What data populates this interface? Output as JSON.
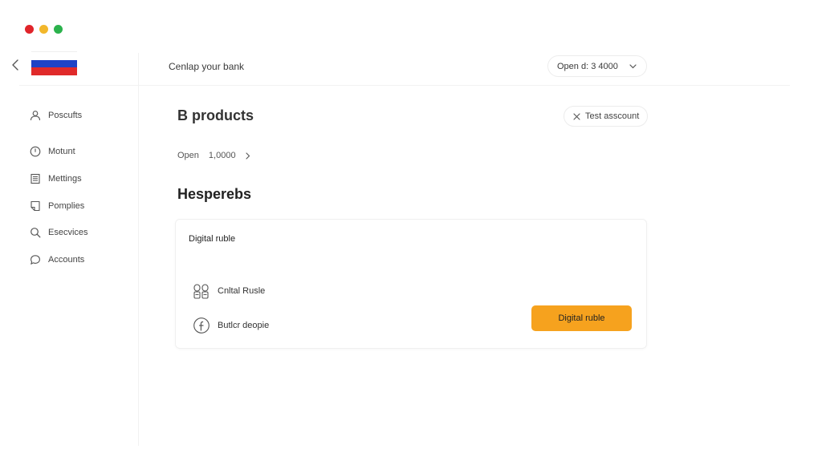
{
  "window": {
    "lights": [
      "#e0242a",
      "#f2b72b",
      "#2bb24c"
    ]
  },
  "topbar": {
    "title": "Cenlap your bank",
    "select_value": "Open d: 3 4000",
    "flag_colors": [
      "#ffffff",
      "#1f43c6",
      "#e02a2a"
    ]
  },
  "sidebar": {
    "items": [
      {
        "label": "Poscufts",
        "icon": "user-icon"
      },
      {
        "label": "Motunt",
        "icon": "clock-icon"
      },
      {
        "label": "Mettings",
        "icon": "document-icon"
      },
      {
        "label": "Pomplies",
        "icon": "page-corner-icon"
      },
      {
        "label": "Esecvices",
        "icon": "search-icon"
      },
      {
        "label": "Accounts",
        "icon": "chat-icon"
      }
    ]
  },
  "main": {
    "title": "B products",
    "test_account_label": "Test asscount",
    "open_row": {
      "label": "Open",
      "value": "1,0000"
    },
    "section_heading": "Hesperebs",
    "card": {
      "title": "Digital ruble",
      "rows": [
        {
          "label": "Cnltal Rusle",
          "icon": "bank-cards-icon"
        },
        {
          "label": "Butlcr deopie",
          "icon": "facebook-icon"
        }
      ],
      "button_label": "Digital ruble",
      "button_color": "#f6a21e"
    }
  }
}
